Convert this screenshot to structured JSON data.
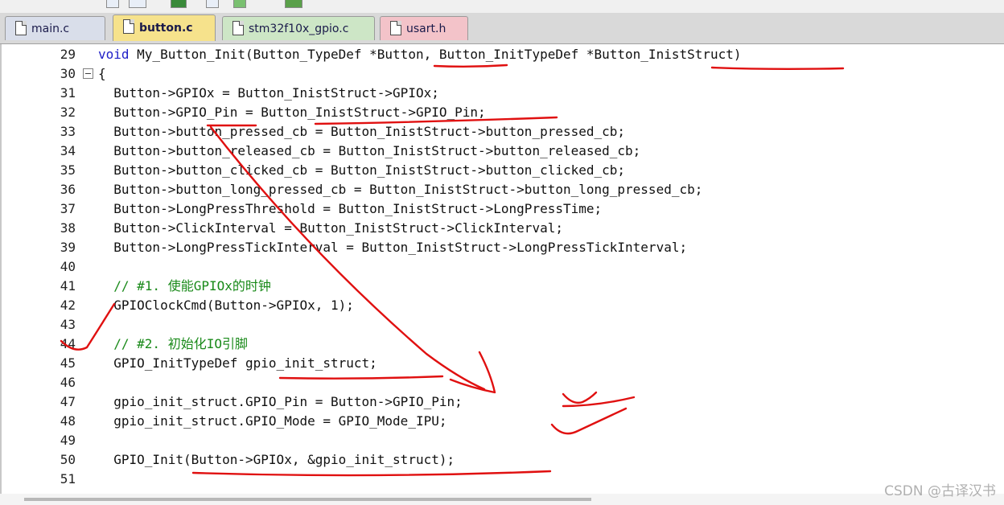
{
  "tabs": [
    {
      "label": "main.c",
      "active": false,
      "color": "#d9deea"
    },
    {
      "label": "button.c",
      "active": true,
      "color": "#f6e28c"
    },
    {
      "label": "stm32f10x_gpio.c",
      "active": false,
      "color": "#cde6c6"
    },
    {
      "label": "usart.h",
      "active": false,
      "color": "#f3c3c9"
    }
  ],
  "editor": {
    "lines": [
      {
        "num": "29",
        "code": " My_Button_Init(Button_TypeDef *Button, Button_InitTypeDef *Button_InistStruct)",
        "keyword": "void"
      },
      {
        "num": "30",
        "code": "{"
      },
      {
        "num": "31",
        "code": "  Button->GPIOx = Button_InistStruct->GPIOx;"
      },
      {
        "num": "32",
        "code": "  Button->GPIO_Pin = Button_InistStruct->GPIO_Pin;"
      },
      {
        "num": "33",
        "code": "  Button->button_pressed_cb = Button_InistStruct->button_pressed_cb;"
      },
      {
        "num": "34",
        "code": "  Button->button_released_cb = Button_InistStruct->button_released_cb;"
      },
      {
        "num": "35",
        "code": "  Button->button_clicked_cb = Button_InistStruct->button_clicked_cb;"
      },
      {
        "num": "36",
        "code": "  Button->button_long_pressed_cb = Button_InistStruct->button_long_pressed_cb;"
      },
      {
        "num": "37",
        "code": "  Button->LongPressThreshold = Button_InistStruct->LongPressTime;"
      },
      {
        "num": "38",
        "code": "  Button->ClickInterval = Button_InistStruct->ClickInterval;"
      },
      {
        "num": "39",
        "code": "  Button->LongPressTickInterval = Button_InistStruct->LongPressTickInterval;"
      },
      {
        "num": "40",
        "code": ""
      },
      {
        "num": "41",
        "code": "  // #1. 使能GPIOx的时钟",
        "comment": true
      },
      {
        "num": "42",
        "code": "  GPIOClockCmd(Button->GPIOx, 1);"
      },
      {
        "num": "43",
        "code": ""
      },
      {
        "num": "44",
        "code": "  // #2. 初始化IO引脚",
        "comment": true
      },
      {
        "num": "45",
        "code": "  GPIO_InitTypeDef gpio_init_struct;"
      },
      {
        "num": "46",
        "code": ""
      },
      {
        "num": "47",
        "code": "  gpio_init_struct.GPIO_Pin = Button->GPIO_Pin;"
      },
      {
        "num": "48",
        "code": "  gpio_init_struct.GPIO_Mode = GPIO_Mode_IPU;"
      },
      {
        "num": "49",
        "code": ""
      },
      {
        "num": "50",
        "code": "  GPIO_Init(Button->GPIOx, &gpio_init_struct);"
      },
      {
        "num": "51",
        "code": ""
      }
    ]
  },
  "watermark": "CSDN @古译汉书",
  "colors": {
    "keyword": "#2020c8",
    "comment": "#1a8a1a",
    "annotation": "#e01010",
    "active_tab": "#f6e28c"
  }
}
